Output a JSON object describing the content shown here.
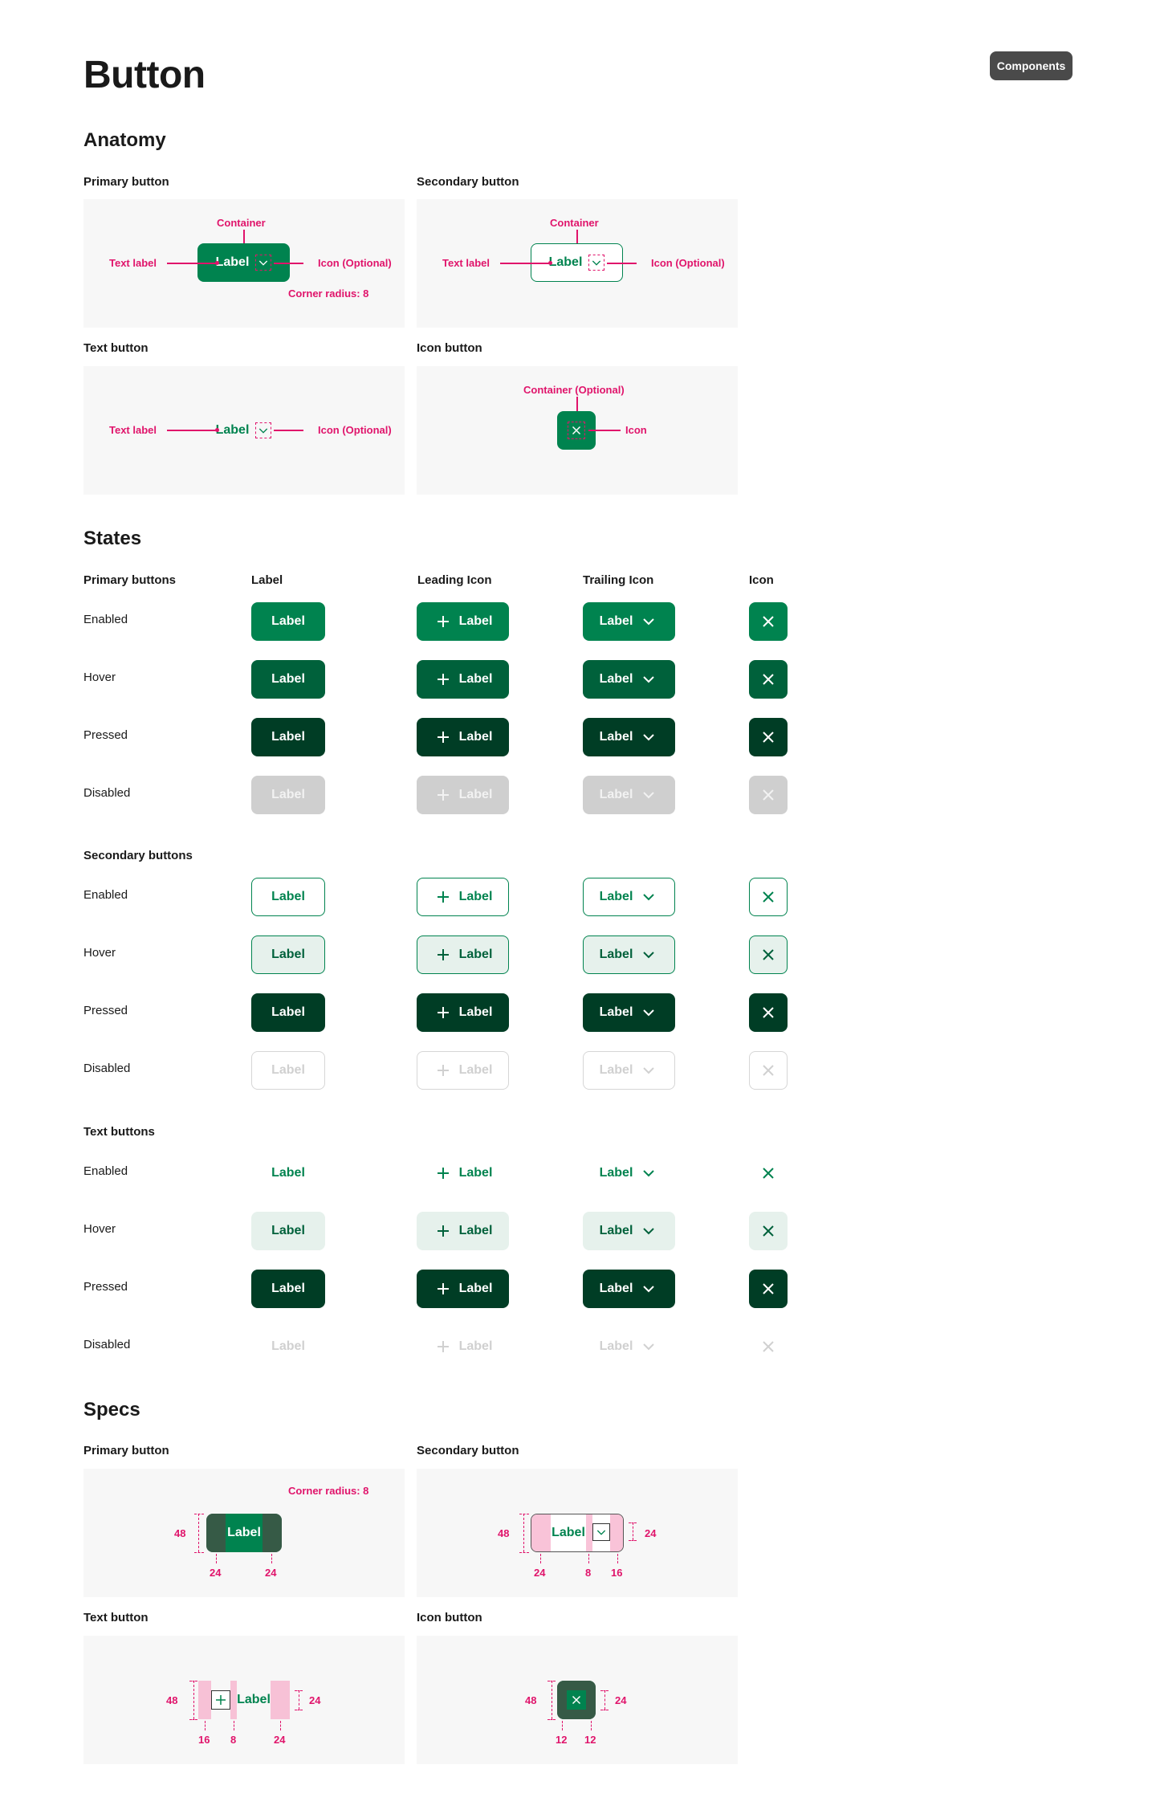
{
  "header": {
    "title": "Button",
    "tag": "Components"
  },
  "anatomy": {
    "title": "Anatomy",
    "panels": [
      {
        "title": "Primary button",
        "container_label": "Container",
        "text_label": "Text label",
        "icon_label": "Icon (Optional)",
        "corner_label": "Corner radius: 8",
        "button_label": "Label"
      },
      {
        "title": "Secondary button",
        "container_label": "Container",
        "text_label": "Text label",
        "icon_label": "Icon (Optional)",
        "button_label": "Label"
      },
      {
        "title": "Text button",
        "text_label": "Text label",
        "icon_label": "Icon (Optional)",
        "button_label": "Label"
      },
      {
        "title": "Icon button",
        "container_label": "Container (Optional)",
        "icon_label": "Icon"
      }
    ]
  },
  "states": {
    "title": "States",
    "columns": [
      "Label",
      "Leading Icon",
      "Trailing Icon",
      "Icon"
    ],
    "button_label": "Label",
    "groups": [
      {
        "title": "Primary buttons",
        "rows": [
          "Enabled",
          "Hover",
          "Pressed",
          "Disabled"
        ]
      },
      {
        "title": "Secondary buttons",
        "rows": [
          "Enabled",
          "Hover",
          "Pressed",
          "Disabled"
        ]
      },
      {
        "title": "Text buttons",
        "rows": [
          "Enabled",
          "Hover",
          "Pressed",
          "Disabled"
        ]
      }
    ]
  },
  "specs": {
    "title": "Specs",
    "panels": [
      {
        "title": "Primary button",
        "corner_label": "Corner radius: 8",
        "button_label": "Label",
        "height": "48",
        "pad_left": "24",
        "pad_right": "24"
      },
      {
        "title": "Secondary button",
        "button_label": "Label",
        "height": "48",
        "pad_left": "24",
        "gap": "8",
        "pad_right": "16",
        "icon_size": "24"
      },
      {
        "title": "Text button",
        "button_label": "Label",
        "height": "48",
        "pad_left": "16",
        "gap": "8",
        "pad_right": "24",
        "icon_size": "24"
      },
      {
        "title": "Icon button",
        "height": "48",
        "icon_size": "24",
        "pad_left": "12",
        "pad_right": "12"
      }
    ]
  },
  "colors": {
    "primary": "#00834f",
    "primary_hover": "#00613b",
    "primary_pressed": "#003d25",
    "disabled": "#cfcfcf",
    "annotation": "#e0146b",
    "panel_bg": "#f7f7f7"
  }
}
